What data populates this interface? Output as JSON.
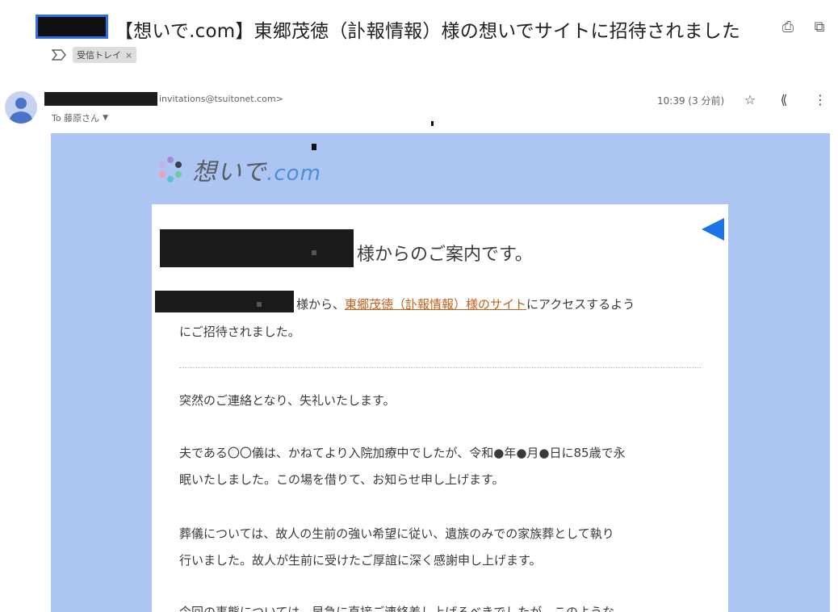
{
  "subject": {
    "title": "【想いで.com】東郷茂徳（訃報情報）様の想いでサイトに招待されました"
  },
  "labels": [
    {
      "text": "受信トレイ",
      "remove": "×"
    }
  ],
  "sender": {
    "email": "invitations@tsuitonet.com>",
    "to": "To 藤原さん",
    "time": "10:39 (3 分前)"
  },
  "icons": {
    "print": "⎙",
    "open_new": "⧉",
    "star": "☆",
    "reply_all": "⟪",
    "more": "⋮"
  },
  "mail": {
    "logo_text": "想いで",
    "logo_dot": ".com",
    "greeting": "様からのご案内です。",
    "invite_prefix": "様から、",
    "invite_link": "東郷茂徳（訃報情報）様のサイト",
    "invite_suffix": "にアクセスするよう",
    "invite_line2": "にご招待されました。",
    "p1": "突然のご連絡となり、失礼いたします。",
    "p2_line1": "夫である〇〇儀は、かねてより入院加療中でしたが、令和●年●月●日に85歳で永",
    "p2_line2": "眠いたしました。この場を借りて、お知らせ申し上げます。",
    "p3_line1": "葬儀については、故人の生前の強い希望に従い、遺族のみでの家族葬として執り",
    "p3_line2": "行いました。故人が生前に受けたご厚誼に深く感謝申し上げます。",
    "p4_line1": "今回の事態については、早急に直接ご連絡差し上げるべきでしたが、このような"
  },
  "colors": {
    "mail_background": "#adc5f2",
    "link": "#c0601a",
    "accent": "#1a73e8"
  }
}
